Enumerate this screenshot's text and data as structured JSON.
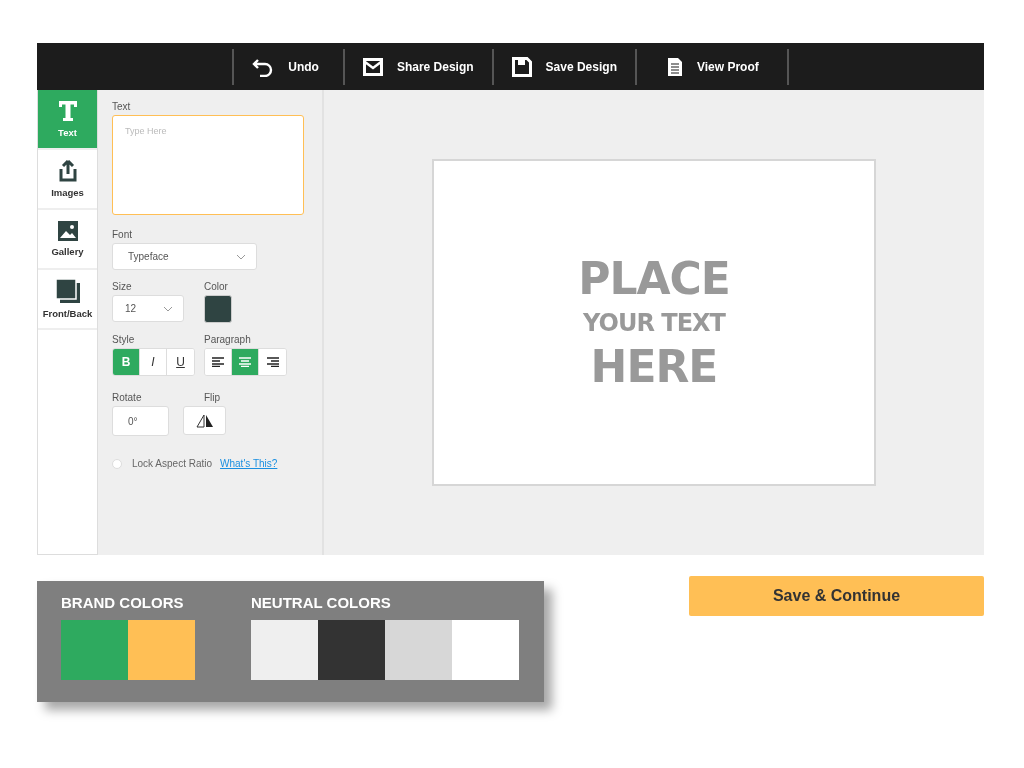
{
  "toolbar": [
    {
      "label": "Undo",
      "kind": "undo"
    },
    {
      "label": "Share Design",
      "kind": "share"
    },
    {
      "label": "Save Design",
      "kind": "save"
    },
    {
      "label": "View Proof",
      "kind": "proof"
    }
  ],
  "sidebar": {
    "items": [
      {
        "label": "Text",
        "kind": "text",
        "selected": true
      },
      {
        "label": "Images",
        "kind": "images",
        "selected": false
      },
      {
        "label": "Gallery",
        "kind": "gallery",
        "selected": false
      },
      {
        "label": "Front/Back",
        "kind": "frontback",
        "selected": false
      }
    ]
  },
  "panel": {
    "text": {
      "label": "Text",
      "placeholder": "Type Here"
    },
    "font": {
      "label": "Font",
      "value": "Typeface"
    },
    "size": {
      "label": "Size",
      "value": "12"
    },
    "color": {
      "label": "Color",
      "color": "#2f4442"
    },
    "style": {
      "label": "Style",
      "buttons": [
        {
          "label": "B",
          "kind": "bold",
          "selected": true
        },
        {
          "label": "I",
          "kind": "italic",
          "selected": false
        },
        {
          "label": "U",
          "kind": "underline",
          "selected": false
        }
      ]
    },
    "paragraph": {
      "label": "Paragraph",
      "buttons": [
        {
          "kind": "left",
          "selected": false
        },
        {
          "kind": "center",
          "selected": true
        },
        {
          "kind": "right",
          "selected": false
        }
      ]
    },
    "rotate": {
      "label": "Rotate",
      "value": "0°"
    },
    "flip": {
      "label": "Flip"
    },
    "lock": {
      "label": "Lock Aspect Ratio",
      "checked": false,
      "link": "What's This?"
    }
  },
  "canvas": {
    "lines": [
      {
        "text": "PLACE",
        "kind": "large"
      },
      {
        "text": "YOUR TEXT",
        "kind": "small"
      },
      {
        "text": "HERE",
        "kind": "large"
      }
    ]
  },
  "palettes": [
    {
      "title": "BRAND COLORS",
      "swatches": [
        {
          "color": "#2eaa5f"
        },
        {
          "color": "#ffbf55"
        }
      ]
    },
    {
      "title": "NEUTRAL COLORS",
      "swatches": [
        {
          "color": "#efefef"
        },
        {
          "color": "#333333"
        },
        {
          "color": "#d7d7d7"
        },
        {
          "color": "#ffffff"
        }
      ]
    }
  ],
  "continue_button": "Save & Continue"
}
